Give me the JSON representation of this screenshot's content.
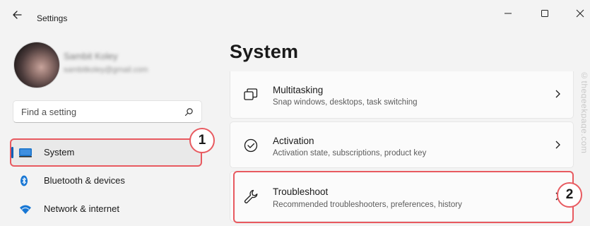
{
  "window": {
    "title": "Settings"
  },
  "user": {
    "name": "Sambit Koley",
    "email": "sambitkoley@gmail.com"
  },
  "search": {
    "placeholder": "Find a setting"
  },
  "sidebar": {
    "items": [
      {
        "label": "System",
        "icon": "monitor-icon",
        "selected": true
      },
      {
        "label": "Bluetooth & devices",
        "icon": "bluetooth-icon",
        "selected": false
      },
      {
        "label": "Network & internet",
        "icon": "wifi-icon",
        "selected": false
      }
    ]
  },
  "main": {
    "title": "System",
    "cards": [
      {
        "title": "Multitasking",
        "subtitle": "Snap windows, desktops, task switching",
        "icon": "multitasking-icon"
      },
      {
        "title": "Activation",
        "subtitle": "Activation state, subscriptions, product key",
        "icon": "activation-check-icon"
      },
      {
        "title": "Troubleshoot",
        "subtitle": "Recommended troubleshooters, preferences, history",
        "icon": "wrench-icon"
      }
    ]
  },
  "annotations": {
    "step1": "1",
    "step2": "2"
  },
  "watermark": "©thegeekpage.com",
  "colors": {
    "accent": "#005fb8",
    "highlight": "#e85a60",
    "background": "#f3f3f3"
  }
}
